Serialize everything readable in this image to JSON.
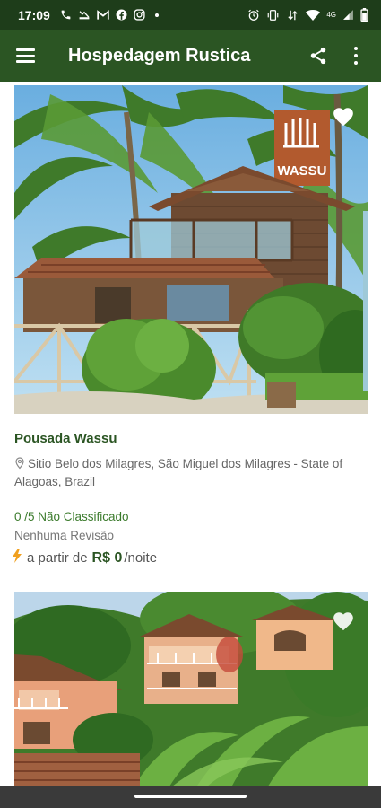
{
  "status_bar": {
    "time": "17:09",
    "left_icons": [
      "phone-icon",
      "missed-call-icon",
      "gmail-icon",
      "facebook-icon",
      "instagram-icon",
      "notification-dot"
    ],
    "right_icons": [
      "alarm-icon",
      "vibrate-icon",
      "data-icon",
      "wifi-icon",
      "signal-icon",
      "battery-icon"
    ],
    "network": "4G"
  },
  "app_bar": {
    "title": "Hospedagem Rustica",
    "background": "#2b5523",
    "menu_icon": "hamburger-menu-icon",
    "share_icon": "share-icon",
    "more_icon": "more-vertical-icon"
  },
  "listings": [
    {
      "name": "Pousada Wassu",
      "sign_text": "WASSU",
      "address": "Sitio Belo dos Milagres, São Miguel dos Milagres - State of Alagoas, Brazil",
      "rating": "0 /5 Não Classificado",
      "reviews": "Nenhuma Revisão",
      "price_prefix": "a partir de",
      "price_amount": "R$ 0",
      "price_suffix": "/noite",
      "favorite_icon": "heart-icon"
    },
    {
      "favorite_icon": "heart-icon"
    }
  ],
  "colors": {
    "status_bar": "#1e3d1a",
    "primary": "#2b5523",
    "rating_green": "#3a7a2b",
    "bolt": "#f0a020"
  }
}
